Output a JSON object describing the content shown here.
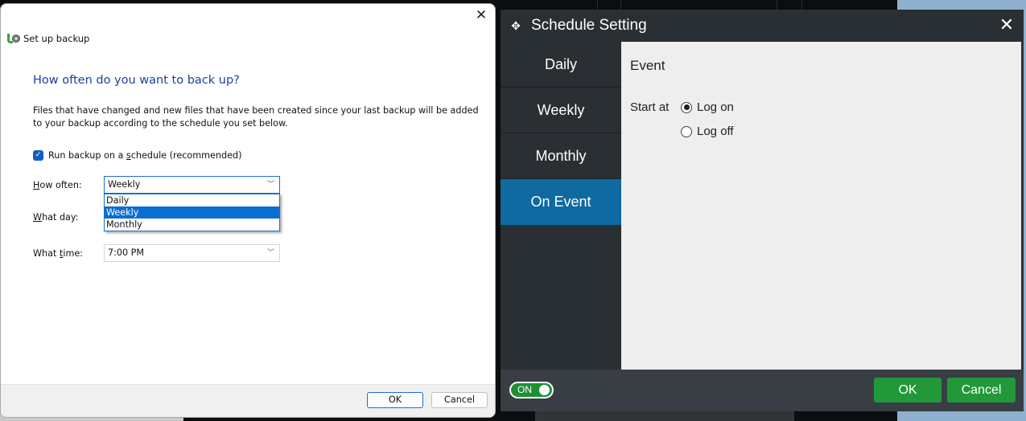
{
  "win_dialog": {
    "title": "Set up backup",
    "close_glyph": "✕",
    "heading": "How often do you want to back up?",
    "description": "Files that have changed and new files that have been created since your last backup will be added to your backup according to the schedule you set below.",
    "schedule_checkbox": {
      "label_pre": "Run backup on a ",
      "label_ul": "s",
      "label_post": "chedule (recommended)",
      "checked": true
    },
    "how_often": {
      "label_ul": "H",
      "label_rest": "ow often:",
      "value": "Weekly",
      "options": [
        "Daily",
        "Weekly",
        "Monthly"
      ],
      "selected_index": 1
    },
    "what_day": {
      "label_ul": "W",
      "label_rest": "hat day:"
    },
    "what_time": {
      "label_pre": "What ",
      "label_ul": "t",
      "label_post": "ime:",
      "value": "7:00 PM"
    },
    "ok_label": "OK",
    "cancel_label": "Cancel",
    "chevron_glyph": "﹀"
  },
  "schedule_setting": {
    "title": "Schedule Setting",
    "close_glyph": "✕",
    "move_glyph": "✥",
    "nav": [
      {
        "label": "Daily",
        "active": false
      },
      {
        "label": "Weekly",
        "active": false
      },
      {
        "label": "Monthly",
        "active": false
      },
      {
        "label": "On Event",
        "active": true
      }
    ],
    "content": {
      "title": "Event",
      "start_at_label": "Start at",
      "options": [
        {
          "label": "Log on",
          "selected": true
        },
        {
          "label": "Log off",
          "selected": false
        }
      ]
    },
    "toggle": {
      "label": "ON",
      "on": true
    },
    "ok_label": "OK",
    "cancel_label": "Cancel",
    "colors": {
      "active_nav": "#0e6aa0",
      "button_green": "#22983a",
      "panel_dark": "#2a2f34"
    }
  }
}
